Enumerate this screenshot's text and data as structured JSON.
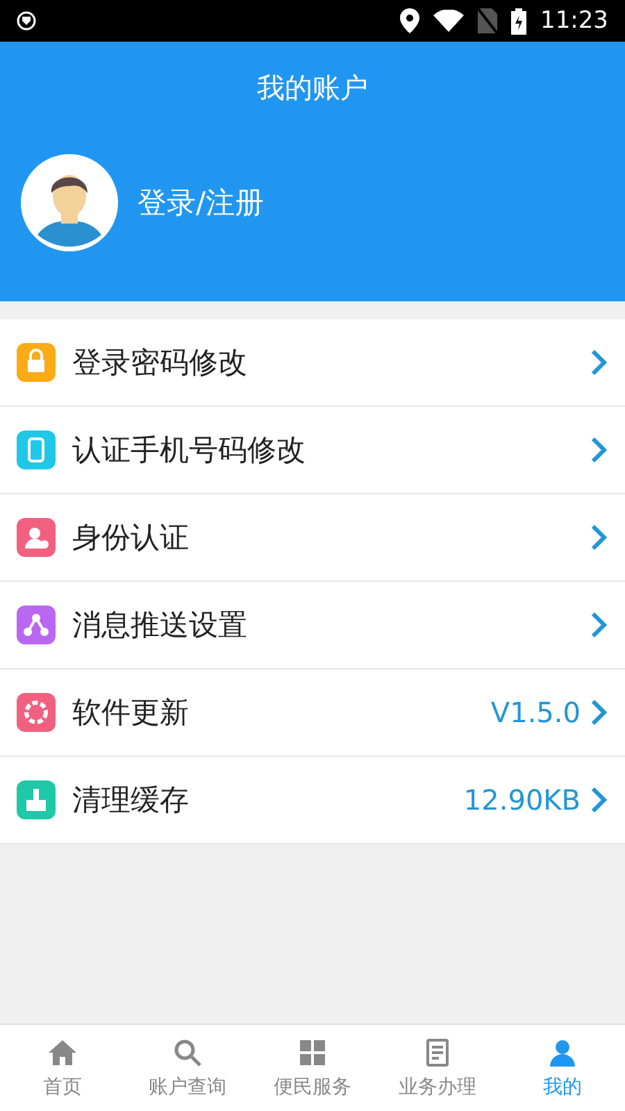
{
  "status_bar": {
    "time": "11:23"
  },
  "header": {
    "title": "我的账户",
    "login_label": "登录/注册"
  },
  "menu": [
    {
      "label": "登录密码修改",
      "color": "#fbab18"
    },
    {
      "label": "认证手机号码修改",
      "color": "#1ec8e6"
    },
    {
      "label": "身份认证",
      "color": "#f2607f"
    },
    {
      "label": "消息推送设置",
      "color": "#b966f2"
    },
    {
      "label": "软件更新",
      "color": "#f2607f",
      "value": "V1.5.0"
    },
    {
      "label": "清理缓存",
      "color": "#1ec8a8",
      "value": "12.90KB"
    }
  ],
  "bottom_nav": [
    {
      "label": "首页",
      "selected": false
    },
    {
      "label": "账户查询",
      "selected": false
    },
    {
      "label": "便民服务",
      "selected": false
    },
    {
      "label": "业务办理",
      "selected": false
    },
    {
      "label": "我的",
      "selected": true
    }
  ]
}
